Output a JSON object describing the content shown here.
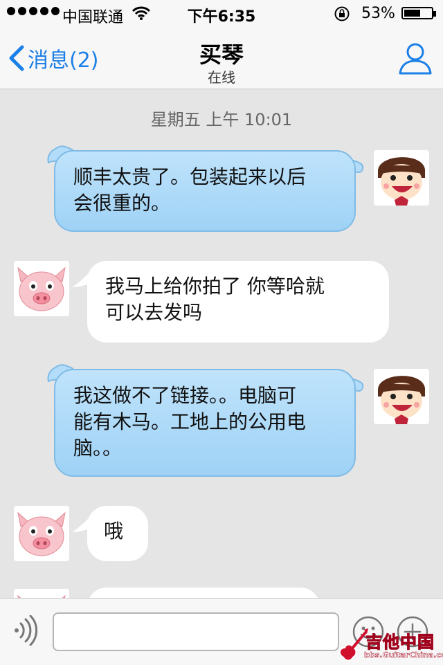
{
  "status_bar": {
    "carrier": "中国联通",
    "time": "下午6:35",
    "battery_percent": "53%",
    "battery_level": 0.53,
    "icons": [
      "signal-dots-icon",
      "wifi-icon",
      "orientation-lock-icon",
      "battery-icon"
    ]
  },
  "nav": {
    "back_label": "消息(2)",
    "title": "买琴",
    "subtitle": "在线",
    "back_icon": "chevron-left-icon",
    "profile_icon": "person-icon",
    "accent_color": "#1a7fe6"
  },
  "chat": {
    "timestamp": "星期五 上午 10:01",
    "messages": [
      {
        "side": "sent",
        "lines": [
          "顺丰太贵了。包装起来以后",
          "会很重的。"
        ]
      },
      {
        "side": "received",
        "lines": [
          "我马上给你拍了 你等哈就",
          "可以去发吗"
        ]
      },
      {
        "side": "sent",
        "lines": [
          "我这做不了链接。。电脑可",
          "能有木马。工地上的公用电",
          "脑。。"
        ]
      },
      {
        "side": "received",
        "lines": [
          "哦"
        ]
      }
    ]
  },
  "input_bar": {
    "value": "",
    "icons": [
      "voice-icon",
      "emoji-icon",
      "plus-icon"
    ]
  },
  "watermark": {
    "title": "吉他中国",
    "url": "bbs.GuitarChina.com"
  },
  "colors": {
    "sent_bubble": "#a8d7f8",
    "received_bubble": "#ffffff",
    "background": "#e5e5e5"
  }
}
